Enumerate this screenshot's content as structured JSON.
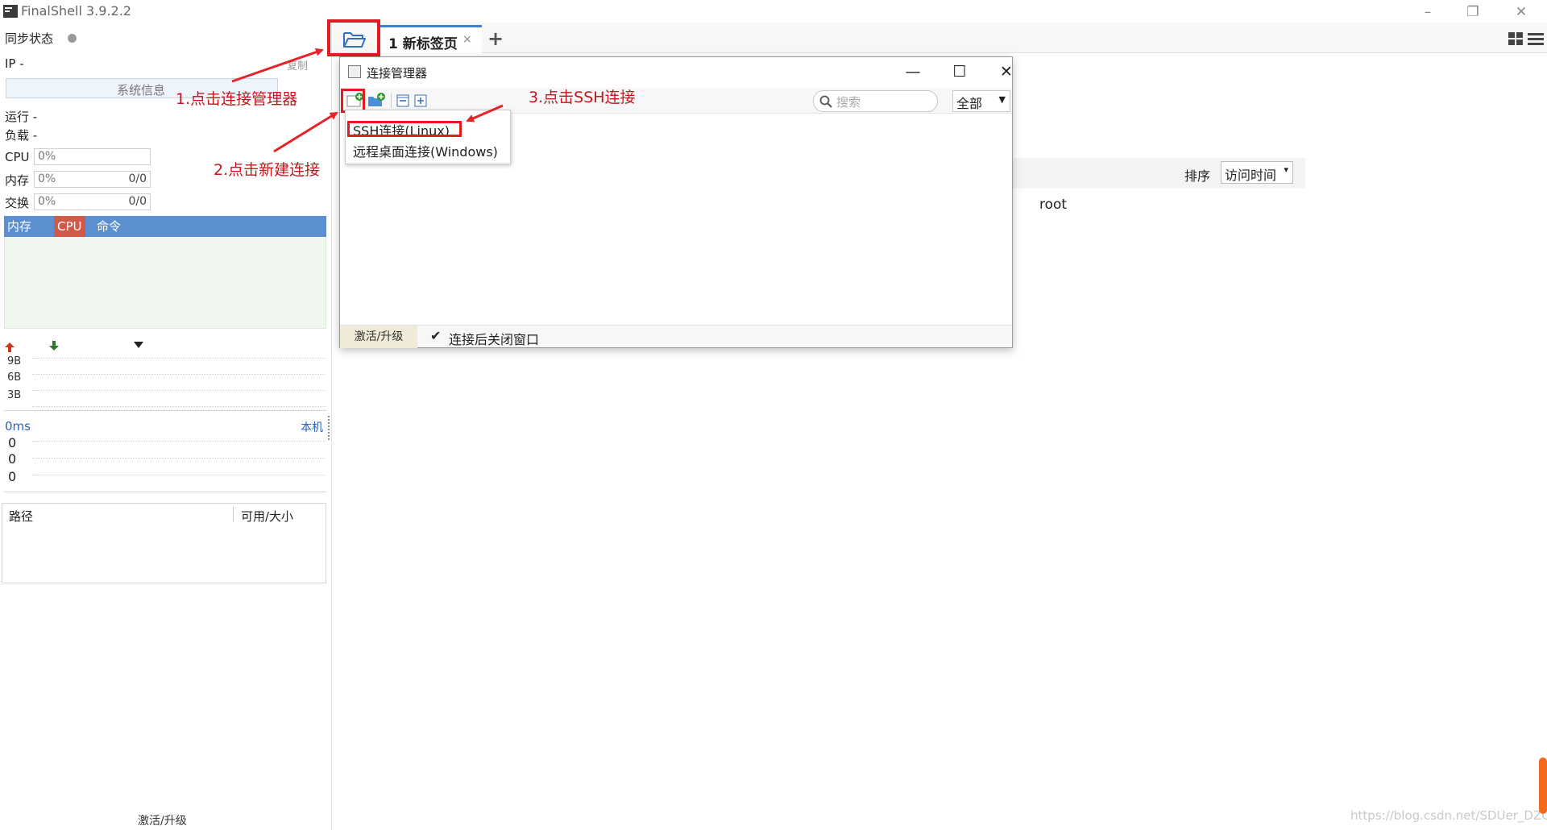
{
  "window": {
    "title": "FinalShell 3.9.2.2",
    "minimize": "–",
    "restore": "❐",
    "close": "✕"
  },
  "left_panel": {
    "sync_label": "同步状态",
    "ip_label": "IP  -",
    "copy_label": "复制",
    "sysinfo_button": "系统信息",
    "run_label": "运行 -",
    "load_label": "负载 -",
    "cpu_label": "CPU",
    "cpu_value": "0%",
    "mem_label": "内存",
    "mem_value": "0%",
    "mem_ratio": "0/0",
    "swap_label": "交换",
    "swap_value": "0%",
    "swap_ratio": "0/0",
    "graph_tabs": [
      "内存",
      "CPU",
      "命令"
    ],
    "net_levels": [
      "9B",
      "6B",
      "3B"
    ],
    "ping_label": "0ms",
    "host_label": "本机",
    "ping_values": [
      "0",
      "0",
      "0"
    ],
    "files_path_header": "路径",
    "files_size_header": "可用/大小",
    "upgrade_label": "激活/升级"
  },
  "tabs": {
    "items": [
      {
        "label": "1 新标签页",
        "close": "×"
      }
    ],
    "add": "+"
  },
  "main": {
    "sort_label": "排序",
    "sort_value": "访问时间",
    "root_label": "root"
  },
  "dialog": {
    "title": "连接管理器",
    "search_placeholder": "搜索",
    "filter_value": "全部",
    "upgrade_label": "激活/升级",
    "close_after_connect_label": "连接后关闭窗口",
    "close_after_connect_checked": true,
    "minimize": "—",
    "maximize": "☐",
    "close": "✕"
  },
  "popup_menu": {
    "items": [
      "SSH连接(Linux)",
      "远程桌面连接(Windows)"
    ]
  },
  "annotations": {
    "step1": "1.点击连接管理器",
    "step2": "2.点击新建连接",
    "step3": "3.点击SSH连接"
  },
  "watermark": "https://blog.csdn.net/SDUer_DZG",
  "colors": {
    "annotation_red": "#e21b23",
    "annotation_text": "#c8141c",
    "tab_accent": "#3d7fd8",
    "graph_header": "#5b8fd0",
    "cpu_tab": "#d05a4a",
    "scroll_thumb": "#f26a1b"
  }
}
